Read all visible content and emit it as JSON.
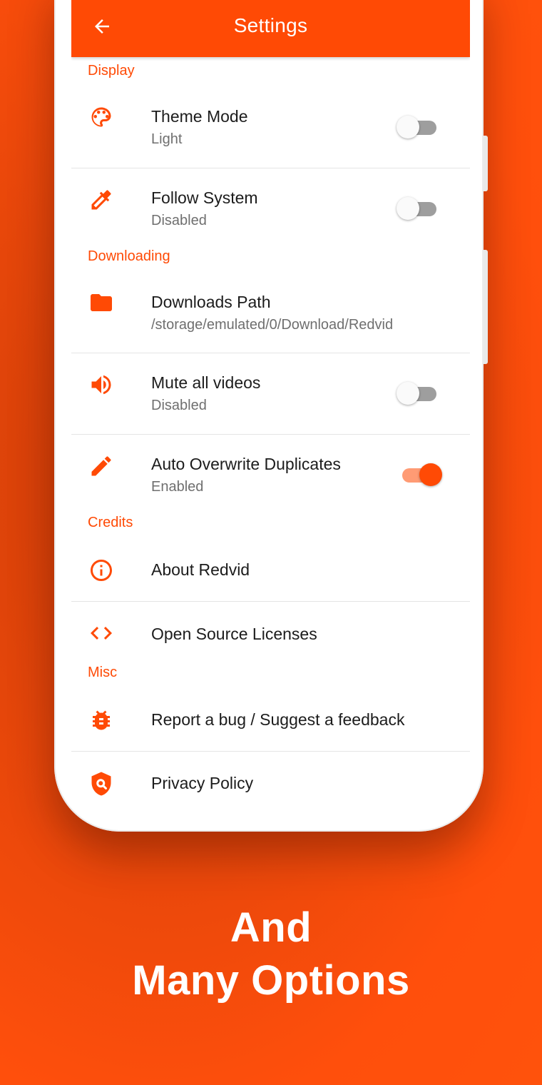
{
  "app_bar": {
    "title": "Settings",
    "back_icon": "arrow-left-icon"
  },
  "accent_color": "#ff4a05",
  "sections": {
    "display": "Display",
    "downloading": "Downloading",
    "credits": "Credits",
    "misc": "Misc"
  },
  "items": {
    "theme_mode": {
      "title": "Theme Mode",
      "subtitle": "Light",
      "icon": "palette-icon",
      "toggle": false
    },
    "follow_system": {
      "title": "Follow System",
      "subtitle": "Disabled",
      "icon": "eyedropper-icon",
      "toggle": false
    },
    "downloads_path": {
      "title": "Downloads Path",
      "subtitle": "/storage/emulated/0/Download/Redvid",
      "icon": "folder-icon"
    },
    "mute_videos": {
      "title": "Mute all videos",
      "subtitle": "Disabled",
      "icon": "volume-icon",
      "toggle": false
    },
    "auto_overwrite": {
      "title": "Auto Overwrite Duplicates",
      "subtitle": "Enabled",
      "icon": "pencil-icon",
      "toggle": true
    },
    "about": {
      "title": "About Redvid",
      "icon": "info-icon"
    },
    "licenses": {
      "title": "Open Source Licenses",
      "icon": "code-icon"
    },
    "report_bug": {
      "title": "Report a bug / Suggest a feedback",
      "icon": "bug-icon"
    },
    "privacy": {
      "title": "Privacy Policy",
      "icon": "shield-search-icon"
    }
  },
  "promo": {
    "line1": "And",
    "line2": "Many Options"
  }
}
